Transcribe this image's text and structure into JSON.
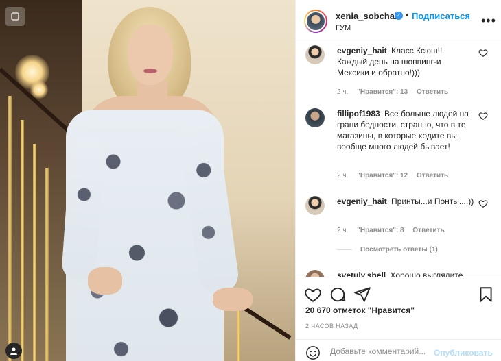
{
  "post": {
    "username": "xenia_sobchak",
    "follow_label": "Подписаться",
    "dot": "•",
    "location": "ГУМ",
    "more_label": "•••"
  },
  "comments": [
    {
      "user": "evgeniy_hait",
      "text": "Класс,Ксюш!! Каждый день на шоппинг-и Мексики и обратно!)))",
      "time": "2 ч.",
      "likes": "\"Нравится\": 13",
      "reply": "Ответить"
    },
    {
      "user": "fillipof1983",
      "text": "Все больше людей на грани бедности, странно, что в те магазины, в которые ходите вы, вообще много людей бывает!",
      "time": "2 ч.",
      "likes": "\"Нравится\": 12",
      "reply": "Ответить"
    },
    {
      "user": "evgeniy_hait",
      "text": "Принты...и Понты....))",
      "time": "2 ч.",
      "likes": "\"Нравится\": 8",
      "reply": "Ответить"
    },
    {
      "user": "svetulv.shell",
      "text": "Хорошо выглядите"
    }
  ],
  "view_replies": "Посмотреть ответы (1)",
  "likes_summary": "20 670 отметок \"Нравится\"",
  "time_ago": "2 ЧАСОВ НАЗАД",
  "add_comment": {
    "placeholder": "Добавьте комментарий...",
    "publish_label": "Опубликовать"
  },
  "colors": {
    "accent": "#0095f6",
    "verified": "#3897f0",
    "muted": "#8e8e8e",
    "publish_disabled": "#b2dffc"
  },
  "icons": [
    "heart-icon",
    "comment-icon",
    "share-icon",
    "bookmark-icon",
    "emoji-icon",
    "verified-icon",
    "more-icon",
    "tag-icon"
  ]
}
